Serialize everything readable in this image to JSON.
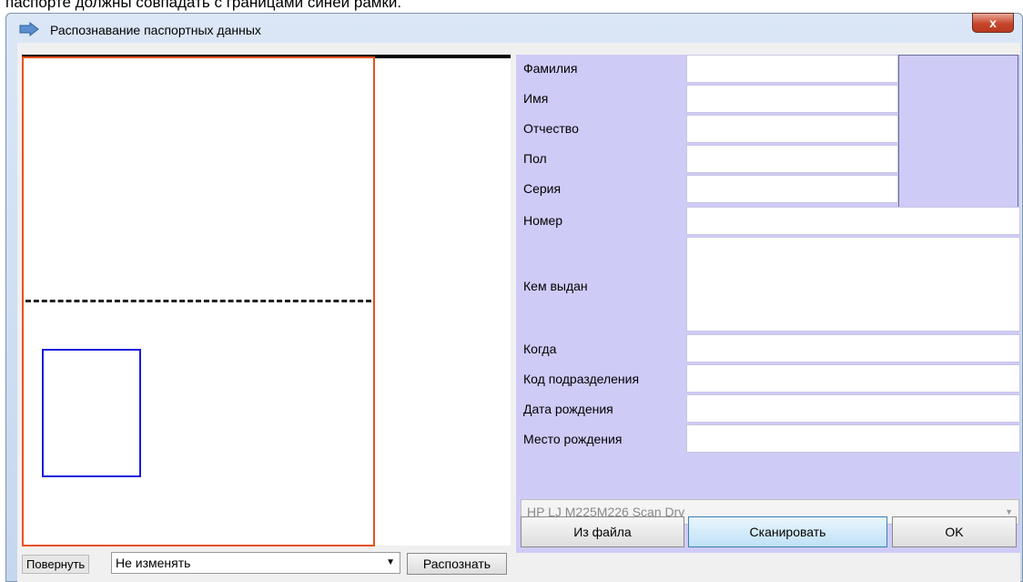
{
  "page_caption": "паспорте должны совпадать с границами синей рамки.",
  "window": {
    "title": "Распознавание паспортных данных",
    "close_label": "x"
  },
  "left_panel": {
    "rotate_label": "Повернуть",
    "rotate_value": "Не изменять",
    "recognize_button": "Распознать"
  },
  "fields": [
    {
      "label": "Фамилия",
      "value": ""
    },
    {
      "label": "Имя",
      "value": ""
    },
    {
      "label": "Отчество",
      "value": ""
    },
    {
      "label": "Пол",
      "value": ""
    },
    {
      "label": "Серия",
      "value": ""
    },
    {
      "label": "Номер",
      "value": ""
    },
    {
      "label": "Кем выдан",
      "value": ""
    },
    {
      "label": "Когда",
      "value": ""
    },
    {
      "label": "Код подразделения",
      "value": ""
    },
    {
      "label": "Дата рождения",
      "value": ""
    },
    {
      "label": "Место рождения",
      "value": ""
    }
  ],
  "scanner": {
    "selected": "HP LJ M225M226 Scan Drv"
  },
  "buttons": {
    "from_file": "Из файла",
    "scan": "Сканировать",
    "ok": "OK"
  },
  "colors": {
    "form_background": "#cfcbf7",
    "orange_frame": "#e8501c",
    "blue_frame": "#1a1ae0",
    "close_button": "#c7452b"
  }
}
